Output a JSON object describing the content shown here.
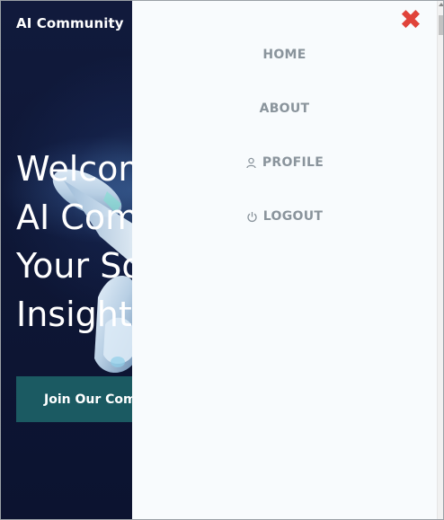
{
  "header": {
    "brand": "AI Community"
  },
  "hero": {
    "title": "Welcome to the\nAI Community:\nYour Source for\nInsights",
    "cta_label": "Join Our Community"
  },
  "menu": {
    "close_symbol": "✖",
    "items": [
      {
        "label": "HOME",
        "icon": ""
      },
      {
        "label": "ABOUT",
        "icon": ""
      },
      {
        "label": "PROFILE",
        "icon": "user-icon"
      },
      {
        "label": "LOGOUT",
        "icon": "power-icon"
      }
    ]
  },
  "colors": {
    "hero_background": "#0f1838",
    "menu_background": "#f8fbfd",
    "menu_text": "#8a949c",
    "close_red": "#e0433a",
    "cta_background": "#1b5a62"
  }
}
